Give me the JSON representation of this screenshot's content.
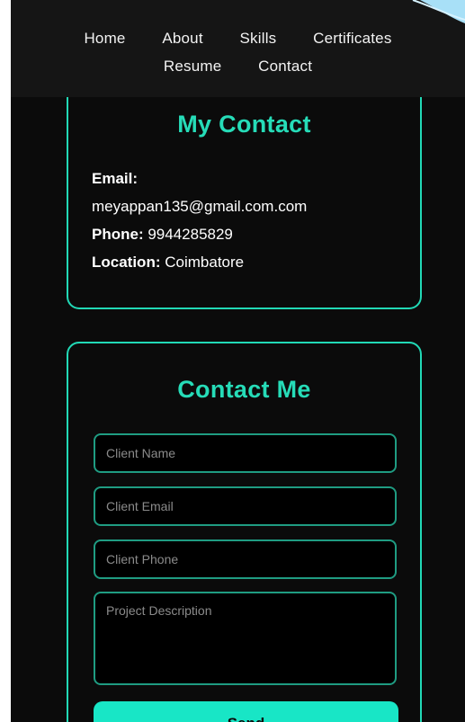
{
  "nav": {
    "items": [
      "Home",
      "About",
      "Skills",
      "Certificates",
      "Resume",
      "Contact"
    ]
  },
  "contact_info": {
    "title": "My Contact",
    "email_label": "Email:",
    "email_value": "meyappan135@gmail.com.com",
    "phone_label": "Phone:",
    "phone_value": "9944285829",
    "location_label": "Location:",
    "location_value": "Coimbatore"
  },
  "contact_form": {
    "title": "Contact Me",
    "name_placeholder": "Client Name",
    "email_placeholder": "Client Email",
    "phone_placeholder": "Client Phone",
    "description_placeholder": "Project Description",
    "submit_label": "Send"
  },
  "colors": {
    "accent": "#21d9b6",
    "button": "#18e6c6",
    "background": "#0b0b0b",
    "nav_background": "#151515"
  }
}
